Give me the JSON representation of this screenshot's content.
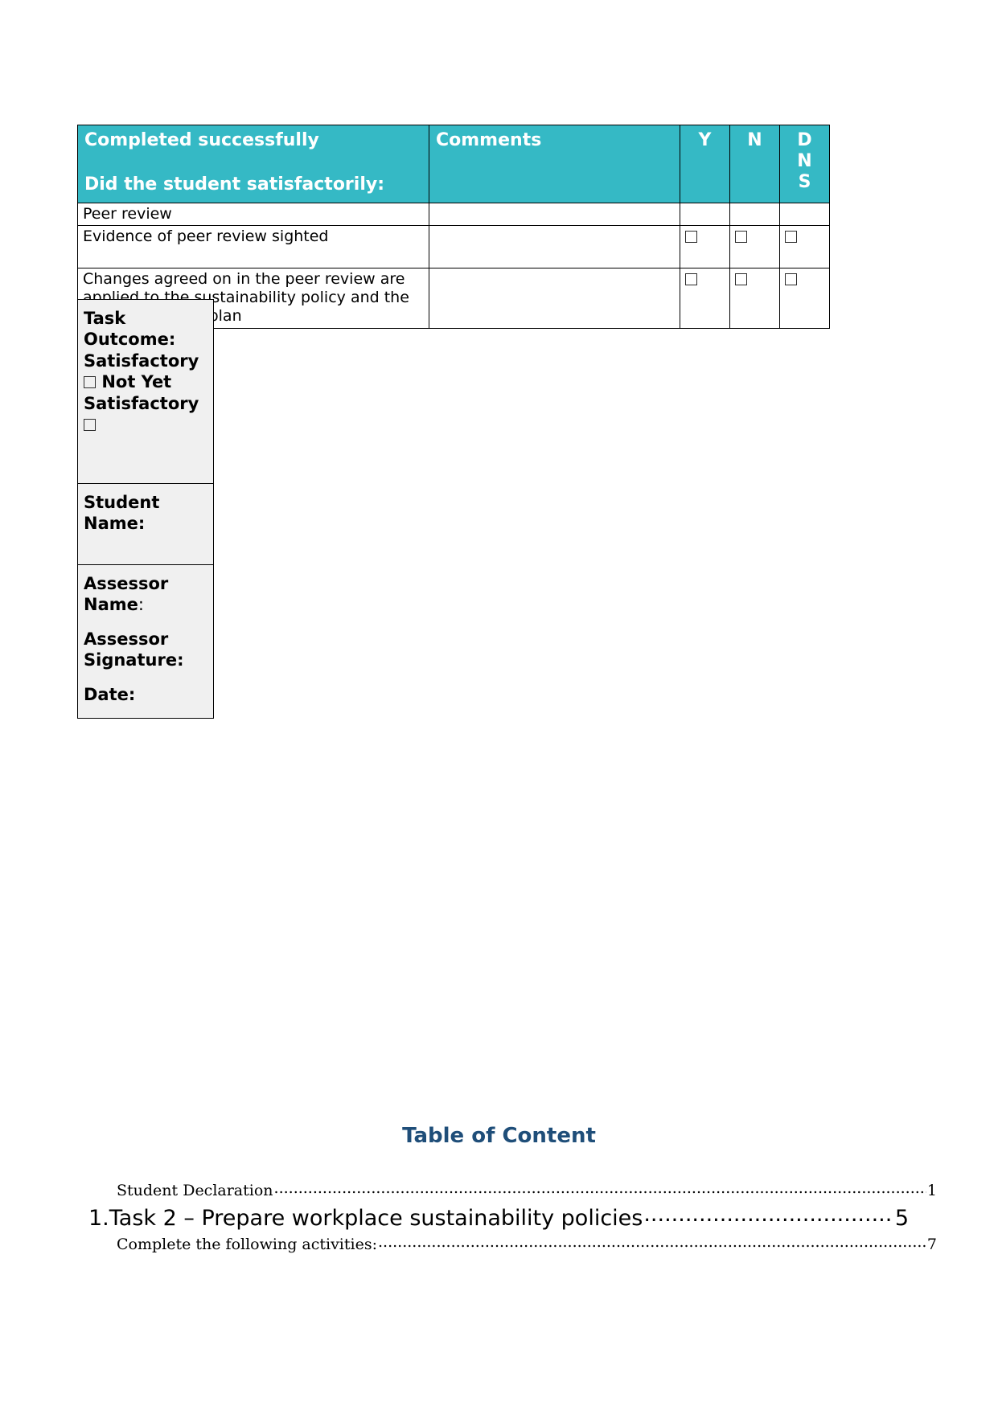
{
  "colors": {
    "header_teal": "#35B9C5",
    "toc_heading": "#1F4E79",
    "outcome_bg": "#f0f0f0"
  },
  "checklist": {
    "headers": {
      "description_line1": "Completed successfully",
      "description_line2": "Did the student satisfactorily:",
      "comments": "Comments",
      "y": "Y",
      "n": "N",
      "dns_d": "D",
      "dns_n": "N",
      "dns_s": "S"
    },
    "rows": [
      {
        "description": "Peer review",
        "comments": "",
        "has_checkboxes": false
      },
      {
        "description": "Evidence of peer review sighted",
        "comments": "",
        "has_checkboxes": true
      },
      {
        "description": "Changes agreed on in the peer review are applied to the sustainability policy and the implementation plan",
        "comments": "",
        "has_checkboxes": true
      }
    ]
  },
  "outcome_block": {
    "task_outcome_label": "Task Outcome:",
    "satisfactory_label": "Satisfactory",
    "not_yet_satisfactory_label": "Not Yet Satisfactory",
    "student_name_label": "Student Name:",
    "assessor_name_label": "Assessor Name",
    "assessor_name_colon": ":",
    "assessor_signature_label": "Assessor Signature:",
    "date_label": "Date:"
  },
  "table_of_content": {
    "title": "Table of Content",
    "entries": [
      {
        "text": "Student Declaration ",
        "page": "1",
        "level": 2
      },
      {
        "text": "1.Task 2 – Prepare workplace sustainability policies",
        "page": "5",
        "level": 1
      },
      {
        "text": "Complete the following activities:",
        "page": "7",
        "level": 2
      }
    ]
  }
}
